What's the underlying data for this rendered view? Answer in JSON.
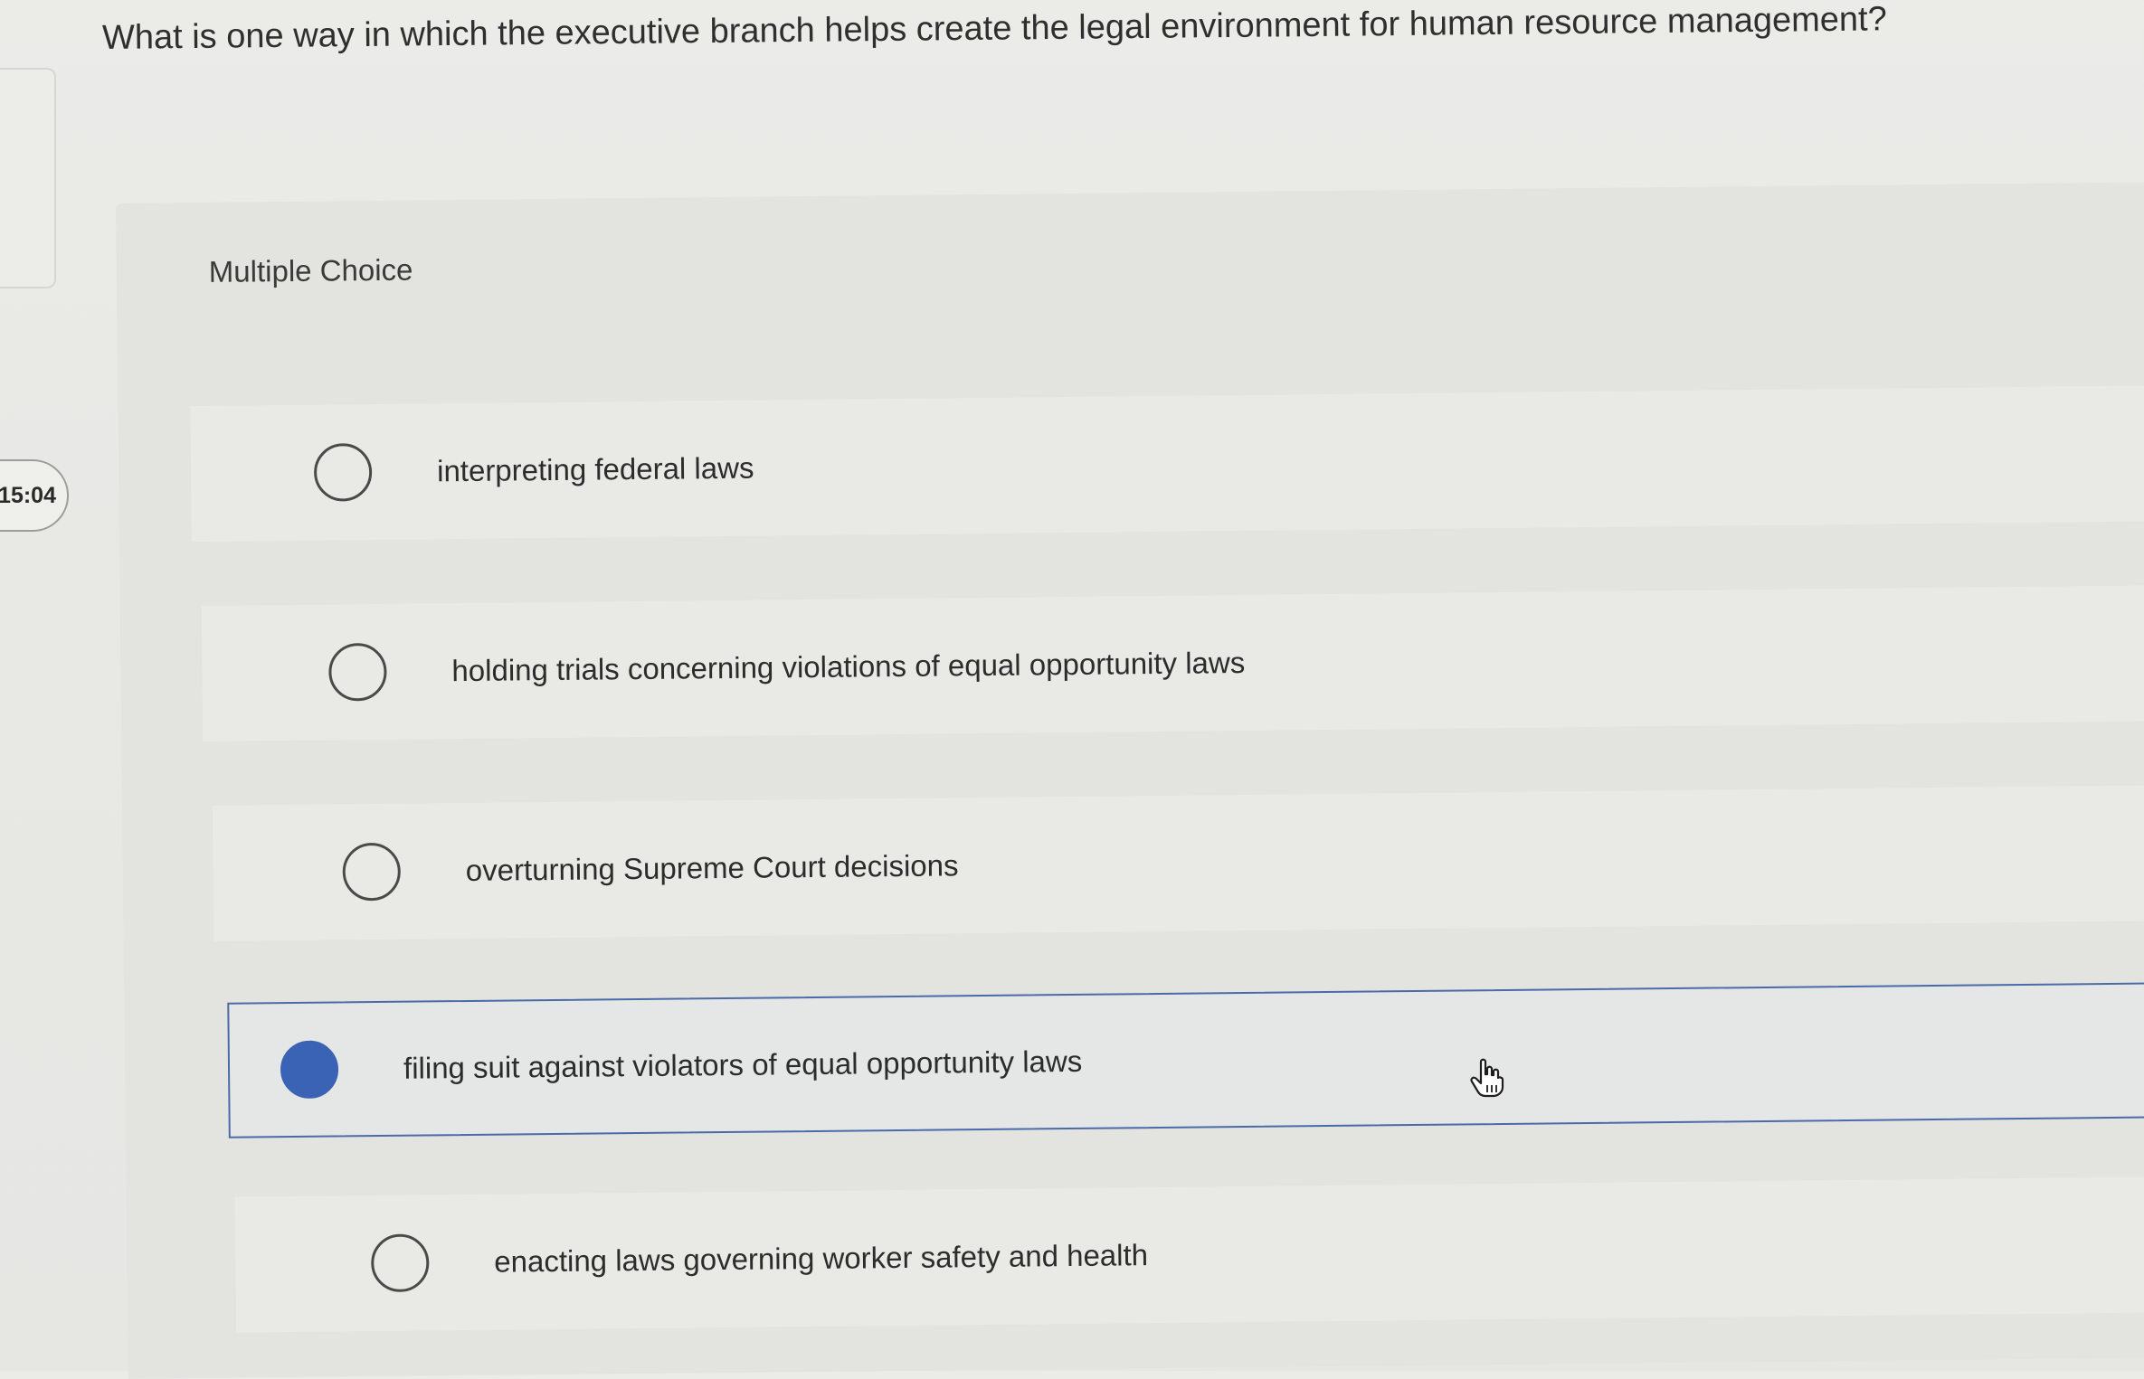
{
  "timer": {
    "text": "15:04"
  },
  "question": {
    "text": "What is one way in which the executive branch helps create the legal environment for human resource management?"
  },
  "panel": {
    "heading": "Multiple Choice"
  },
  "options": [
    {
      "label": "interpreting federal laws",
      "selected": false
    },
    {
      "label": "holding trials concerning violations of equal opportunity laws",
      "selected": false
    },
    {
      "label": "overturning Supreme Court decisions",
      "selected": false
    },
    {
      "label": "filing suit against violators of equal opportunity laws",
      "selected": true
    },
    {
      "label": "enacting laws governing worker safety and health",
      "selected": false
    }
  ],
  "colors": {
    "accent": "#3b63b5",
    "selected_border": "#4a6aa8"
  },
  "icons": {
    "pointer": "hand-pointer-icon"
  }
}
